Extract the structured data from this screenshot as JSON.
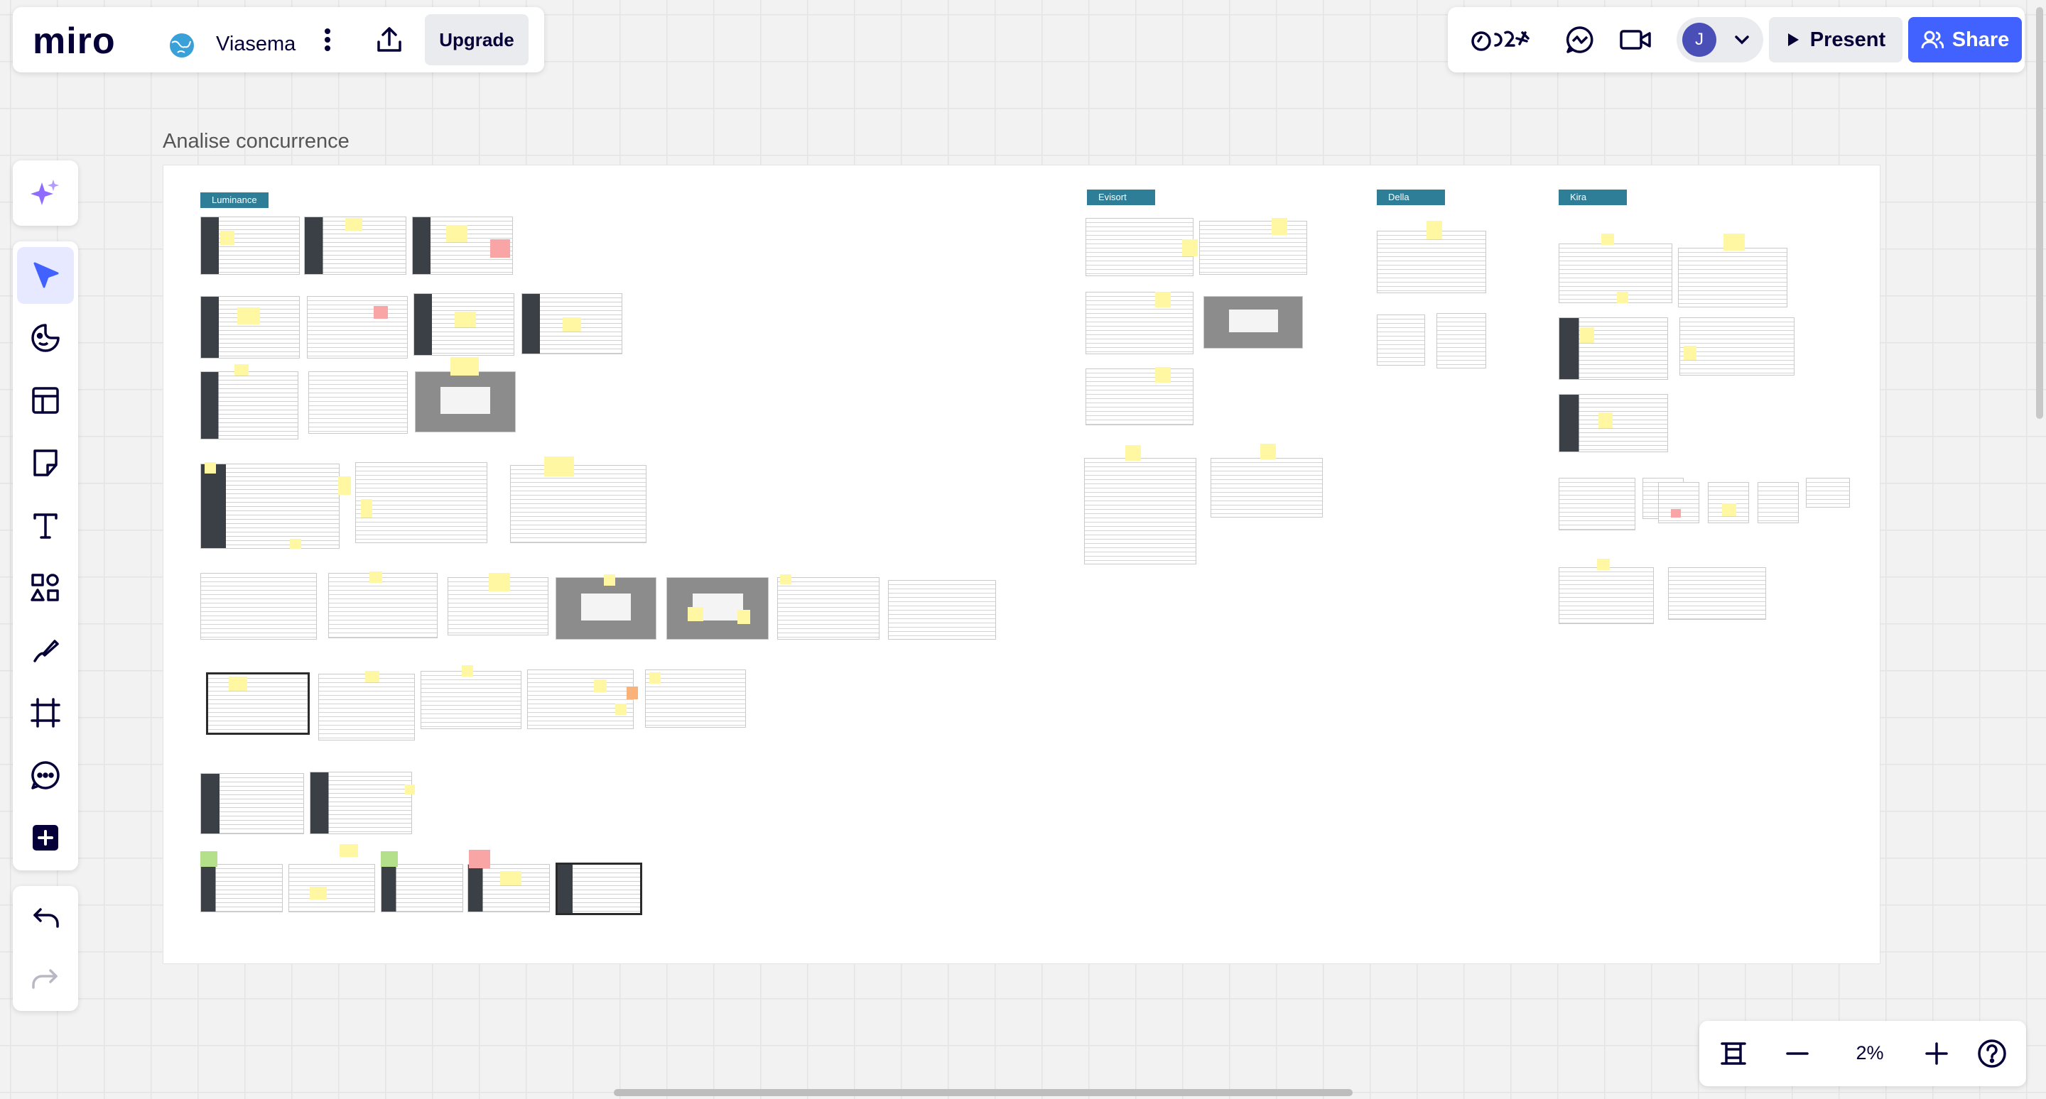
{
  "app": {
    "logo": "miro",
    "board_name": "Viasema",
    "upgrade_label": "Upgrade"
  },
  "topbar_right": {
    "avatar_initial": "J",
    "present_label": "Present",
    "share_label": "Share"
  },
  "toolbar": {
    "tools": [
      "ai-assist",
      "select",
      "stickers",
      "templates",
      "sticky-note",
      "text",
      "shapes",
      "pen",
      "frame",
      "comment",
      "more-apps"
    ],
    "active_tool": "select"
  },
  "zoom": {
    "level": "2%"
  },
  "canvas": {
    "frame_title": "Analise concurrence",
    "tags": {
      "luminance": "Luminance",
      "evisort": "Evisort",
      "della": "Della",
      "kira": "Kira"
    }
  },
  "colors": {
    "accent": "#4262ff",
    "tag": "#2e7e98",
    "sticky": "#fff7a1"
  }
}
